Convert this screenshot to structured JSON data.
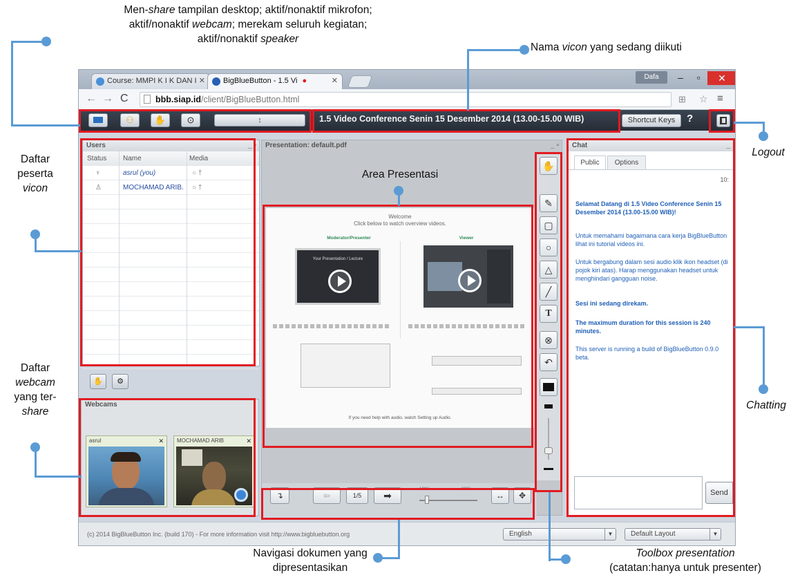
{
  "annotations": {
    "toolbar_desc": {
      "line1_a": "Men-",
      "line1_b": "share",
      "line1_c": " tampilan desktop; aktif/nonaktif mikrofon;",
      "line2_a": "aktif/nonaktif ",
      "line2_b": "webcam",
      "line2_c": "; merekam seluruh kegiatan;",
      "line3_a": "aktif/nonaktif ",
      "line3_b": "speaker"
    },
    "vicon_name": {
      "a": "Nama ",
      "b": "vicon",
      "c": " yang sedang diikuti"
    },
    "participants": {
      "l1": "Daftar",
      "l2": "peserta",
      "l3": "vicon"
    },
    "presentation_area": "Area Presentasi",
    "logout": "Logout",
    "webcam_list": {
      "l1": "Daftar",
      "l2": "webcam",
      "l3": "yang ter-",
      "l4": "share"
    },
    "chatting": "Chatting",
    "doc_nav": {
      "l1": "Navigasi dokumen yang",
      "l2": "dipresentasikan"
    },
    "toolbox": {
      "l1": "Toolbox presentation",
      "l2": "(catatan:hanya untuk presenter)"
    }
  },
  "browser": {
    "tabs": [
      {
        "label": "Course: MMPI K I K DAN I"
      },
      {
        "label": "BigBlueButton - 1.5 Vi"
      }
    ],
    "user_badge": "Dafa",
    "url_domain": "bbb.siap.id",
    "url_path": "/client/BigBlueButton.html"
  },
  "bbb": {
    "volume_label": "↕",
    "conference_title": "1.5 Video Conference Senin 15 Desember 2014  (13.00-15.00 WIB)",
    "shortcut_keys": "Shortcut Keys",
    "help": "?"
  },
  "users": {
    "title": "Users",
    "columns": [
      "Status",
      "Name",
      "Media"
    ],
    "rows": [
      {
        "name": "asrul (you)",
        "media": "○ †"
      },
      {
        "name": "MOCHAMAD ARIB.",
        "media": "○ †"
      }
    ]
  },
  "webcams": {
    "title": "Webcams",
    "feeds": [
      {
        "name": "asrul"
      },
      {
        "name": "MOCHAMAD ARIB"
      }
    ]
  },
  "presentation": {
    "title": "Presentation: default.pdf",
    "slide_title": "Welcome",
    "slide_subtitle": "Click below to watch overview videos.",
    "slide_left_head": "Moderator/Presenter",
    "slide_right_head": "Viewer",
    "slide_video_text": "Your Presentation / Lecture",
    "slide_footer": "If you need help with audio, watch Setting up Audio.",
    "page": "1/5",
    "zoom_left": "100%",
    "zoom_right": "400%"
  },
  "chat": {
    "title": "Chat",
    "tabs": [
      "Public",
      "Options"
    ],
    "time": "10:",
    "messages": [
      "Selamat Datang di 1.5 Video Conference Senin 15 Desember 2014 (13.00-15.00 WIB)!",
      "Untuk memahami bagaimana cara kerja BigBlueButton lihat ini tutorial videos ini.",
      "Untuk bergabung dalam sesi audio klik ikon headset (di pojok kiri atas). Harap menggunakan headset untuk menghindari gangguan noise.",
      "Sesi ini sedang direkam.",
      "The maximum duration for this session is 240 minutes.",
      "This server is running a build of BigBlueButton 0.9.0 beta."
    ],
    "send": "Send"
  },
  "status": {
    "copyright": "(c) 2014 BigBlueButton Inc. (build 170) - For more information visit http://www.bigbluebutton.org",
    "language": "English",
    "layout": "Default Layout"
  },
  "colors": {
    "highlight": "#e11b22",
    "leader": "#5b9bd5",
    "chat_text": "#1f5fb6"
  }
}
